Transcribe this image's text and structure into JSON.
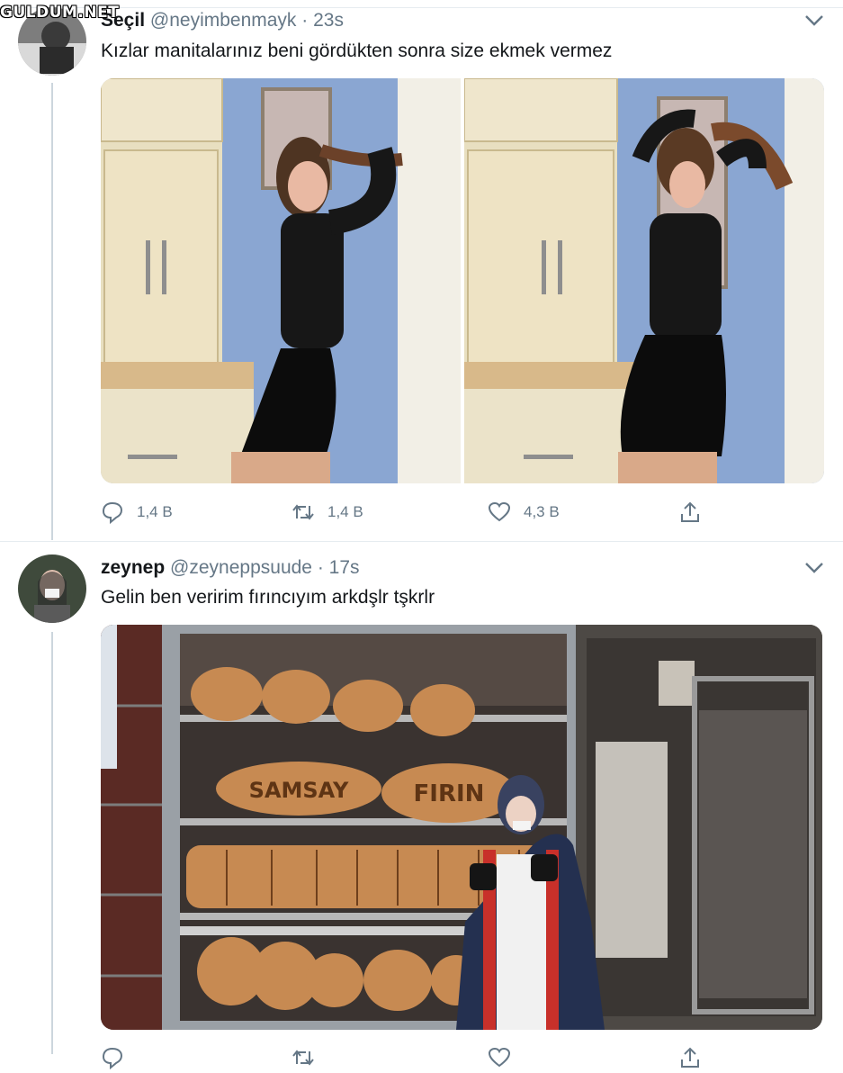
{
  "watermark": "GULDUM.NET",
  "tweets": [
    {
      "name": "Seçil",
      "handle": "@neyimbenmayk",
      "time": "23s",
      "text": "Kızlar manitalarınız beni gördükten sonra size ekmek vermez",
      "replies": "1,4 B",
      "retweets": "1,4 B",
      "likes": "4,3 B"
    },
    {
      "name": "zeynep",
      "handle": "@zeyneppsuude",
      "time": "17s",
      "text": "Gelin ben veririm fırıncıyım arkdşlr tşkrlr"
    }
  ],
  "bakery_signs": [
    "SAMSAY",
    "FIRIN"
  ]
}
